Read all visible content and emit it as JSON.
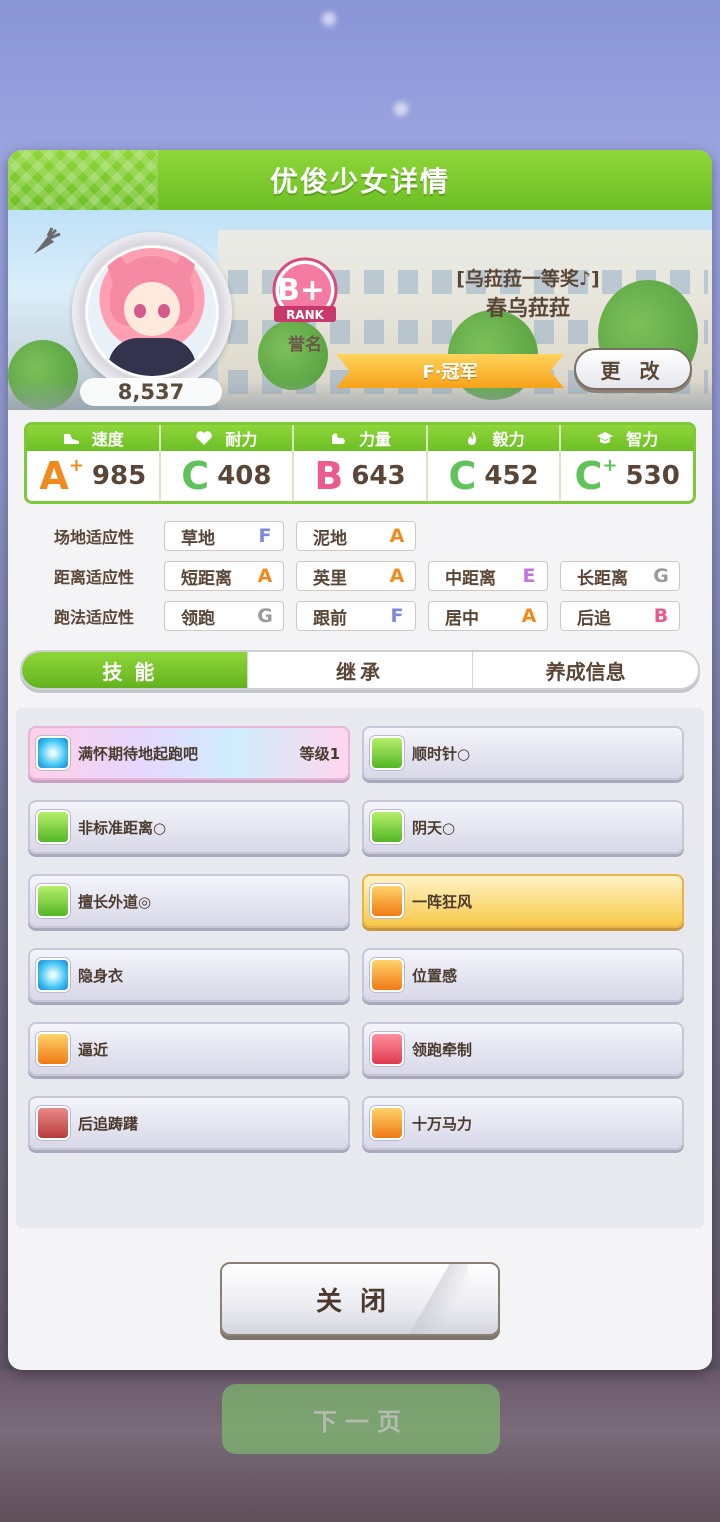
{
  "backdrop": {
    "next_label": "下一页"
  },
  "dialog": {
    "title": "优俊少女详情",
    "profile": {
      "fans": "8,537",
      "rank_caption": "誉名",
      "rank_badge": {
        "grade": "B+",
        "sub": "RANK"
      },
      "epithet": "[乌菈菈一等奖♪]",
      "name": "春乌菈菈",
      "title_ribbon": "F·冠军",
      "change_label": "更 改"
    },
    "stats": [
      {
        "label": "速度",
        "grade": "A",
        "plus": "+",
        "value": "985",
        "icon": "shoe-icon"
      },
      {
        "label": "耐力",
        "grade": "C",
        "plus": "",
        "value": "408",
        "icon": "heart-icon"
      },
      {
        "label": "力量",
        "grade": "B",
        "plus": "",
        "value": "643",
        "icon": "muscle-icon"
      },
      {
        "label": "毅力",
        "grade": "C",
        "plus": "",
        "value": "452",
        "icon": "flame-icon"
      },
      {
        "label": "智力",
        "grade": "C",
        "plus": "+",
        "value": "530",
        "icon": "graduation-cap-icon"
      }
    ],
    "aptitude": {
      "track": {
        "label": "场地适应性",
        "items": [
          {
            "name": "草地",
            "grade": "F"
          },
          {
            "name": "泥地",
            "grade": "A"
          }
        ]
      },
      "distance": {
        "label": "距离适应性",
        "items": [
          {
            "name": "短距离",
            "grade": "A"
          },
          {
            "name": "英里",
            "grade": "A"
          },
          {
            "name": "中距离",
            "grade": "E"
          },
          {
            "name": "长距离",
            "grade": "G"
          }
        ]
      },
      "style": {
        "label": "跑法适应性",
        "items": [
          {
            "name": "领跑",
            "grade": "G"
          },
          {
            "name": "跟前",
            "grade": "F"
          },
          {
            "name": "居中",
            "grade": "A"
          },
          {
            "name": "后追",
            "grade": "B"
          }
        ]
      }
    },
    "tabs": [
      {
        "label": "技能",
        "active": true
      },
      {
        "label": "继承",
        "active": false
      },
      {
        "label": "养成信息",
        "active": false
      }
    ],
    "skills": [
      {
        "name": "满怀期待地起跑吧",
        "level": "等级1",
        "style": "rainbow",
        "icon": "blue"
      },
      {
        "name": "顺时针○",
        "level": "",
        "style": "normal",
        "icon": "green"
      },
      {
        "name": "非标准距离○",
        "level": "",
        "style": "normal",
        "icon": "green"
      },
      {
        "name": "阴天○",
        "level": "",
        "style": "normal",
        "icon": "green"
      },
      {
        "name": "擅长外道◎",
        "level": "",
        "style": "normal",
        "icon": "green"
      },
      {
        "name": "一阵狂风",
        "level": "",
        "style": "gold",
        "icon": "orange"
      },
      {
        "name": "隐身衣",
        "level": "",
        "style": "normal",
        "icon": "blue"
      },
      {
        "name": "位置感",
        "level": "",
        "style": "normal",
        "icon": "orange"
      },
      {
        "name": "逼近",
        "level": "",
        "style": "normal",
        "icon": "orange"
      },
      {
        "name": "领跑牵制",
        "level": "",
        "style": "normal",
        "icon": "red"
      },
      {
        "name": "后追踌躇",
        "level": "",
        "style": "normal",
        "icon": "brown"
      },
      {
        "name": "十万马力",
        "level": "",
        "style": "normal",
        "icon": "orange"
      }
    ],
    "close_label": "关闭"
  }
}
